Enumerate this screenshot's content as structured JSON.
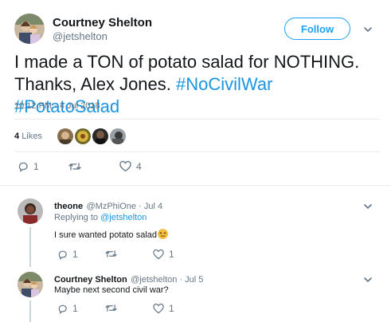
{
  "main_tweet": {
    "author_name": "Courtney Shelton",
    "author_handle": "@jetshelton",
    "follow_label": "Follow",
    "text_line1": "I made a TON of potato salad for NOTHING.",
    "text_line2_plain": "Thanks, Alex Jones. ",
    "hashtag1": "#NoCivilWar",
    "hashtag2": "#PotatoSalad",
    "timestamp": "10:12 PM - 4 Jul 2018",
    "likes_count": "4",
    "likes_word": "Likes",
    "reply_count": "1",
    "retweet_count": "",
    "like_count": "4"
  },
  "replies": [
    {
      "name": "theone",
      "handle": "@MzPhiOne",
      "date": "Jul 4",
      "replying_prefix": "Replying to ",
      "replying_handle": "@jetshelton",
      "text": "I sure wanted potato salad",
      "emoji_icon": "persevering-face-emoji",
      "reply_count": "1",
      "retweet_count": "",
      "like_count": "1"
    },
    {
      "name": "Courtney Shelton",
      "handle": "@jetshelton",
      "date": "Jul 5",
      "text": "Maybe next second civil war?",
      "reply_count": "1",
      "retweet_count": "",
      "like_count": "1"
    }
  ],
  "colors": {
    "accent": "#1da1f2",
    "link": "#1b95e0",
    "muted": "#657786",
    "divider": "#e6ecf0",
    "thread": "#ccd6dd"
  }
}
